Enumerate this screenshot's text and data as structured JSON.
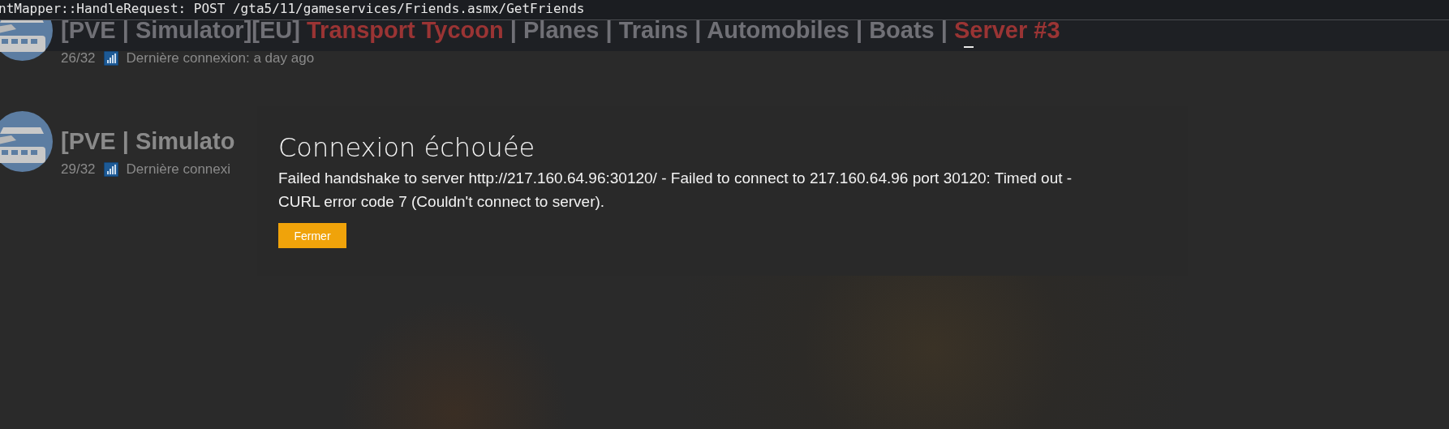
{
  "console": {
    "text": "ntMapper::HandleRequest: POST /gta5/11/gameservices/Friends.asmx/GetFriends"
  },
  "servers": [
    {
      "title_parts": [
        {
          "text": "[PVE | Simulator][EU] ",
          "color": "#707076"
        },
        {
          "text": "Transport Tycoon",
          "color": "#9a3434"
        },
        {
          "text": " | Planes | Trains | Automobiles | Boats | ",
          "color": "#707076"
        },
        {
          "text": "Server #3",
          "color": "#9a3434"
        }
      ],
      "players": "26/32",
      "last_connection": "Dernière connexion: a day ago"
    },
    {
      "title_parts": [
        {
          "text": "[PVE | Simulato",
          "color": "#8a8a8a"
        }
      ],
      "players": "29/32",
      "last_connection": "Dernière connexi"
    }
  ],
  "dialog": {
    "title": "Connexion échouée",
    "message": "Failed handshake to server http://217.160.64.96:30120/ - Failed to connect to 217.160.64.96 port 30120: Timed out - CURL error code 7 (Couldn't connect to server).",
    "button": "Fermer"
  }
}
